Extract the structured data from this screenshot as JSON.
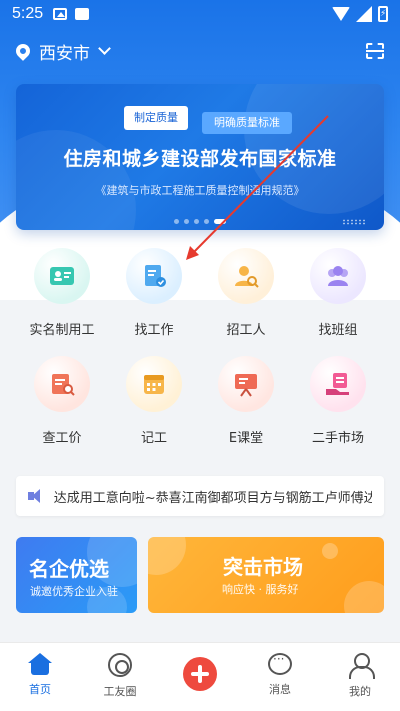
{
  "status_bar": {
    "time": "5:25"
  },
  "location": {
    "city": "西安市"
  },
  "banner": {
    "tag_primary": "制定质量",
    "tag_secondary": "明确质量标准",
    "title": "住房和城乡建设部发布国家标准",
    "subtitle": "《建筑与市政工程施工质量控制通用规范》"
  },
  "grid": {
    "items": [
      {
        "label": "实名制用工",
        "icon": "id-card-icon",
        "bg": "#d9f6f1",
        "fg": "#37c7b1"
      },
      {
        "label": "找工作",
        "icon": "job-doc-icon",
        "bg": "#dbefff",
        "fg": "#4fa9ef"
      },
      {
        "label": "招工人",
        "icon": "worker-search-icon",
        "bg": "#fff0d9",
        "fg": "#f7b548"
      },
      {
        "label": "找班组",
        "icon": "team-icon",
        "bg": "#ece7ff",
        "fg": "#9a83f0"
      },
      {
        "label": "查工价",
        "icon": "price-search-icon",
        "bg": "#ffe5df",
        "fg": "#f07458"
      },
      {
        "label": "记工",
        "icon": "calendar-icon",
        "bg": "#fff1d6",
        "fg": "#f7b64a"
      },
      {
        "label": "E课堂",
        "icon": "classroom-board-icon",
        "bg": "#ffe6e1",
        "fg": "#ef6a55"
      },
      {
        "label": "二手市场",
        "icon": "market-icon",
        "bg": "#ffe2ee",
        "fg": "#f25a94"
      }
    ]
  },
  "notice": {
    "text": "达成用工意向啦~恭喜江南御都项目方与钢筋工卢师傅达"
  },
  "promos": {
    "left": {
      "title": "名企优选",
      "subtitle": "诚邀优秀企业入驻"
    },
    "right": {
      "title": "突击市场",
      "subtitle": "响应快 · 服务好"
    }
  },
  "tabbar": {
    "tabs": [
      {
        "label": "首页"
      },
      {
        "label": "工友圈"
      },
      {
        "label": ""
      },
      {
        "label": "消息"
      },
      {
        "label": "我的"
      }
    ]
  },
  "colors": {
    "brand_blue": "#1a73e8",
    "annotation_red": "#e63a2e",
    "publish_red": "#ee4a3e"
  }
}
